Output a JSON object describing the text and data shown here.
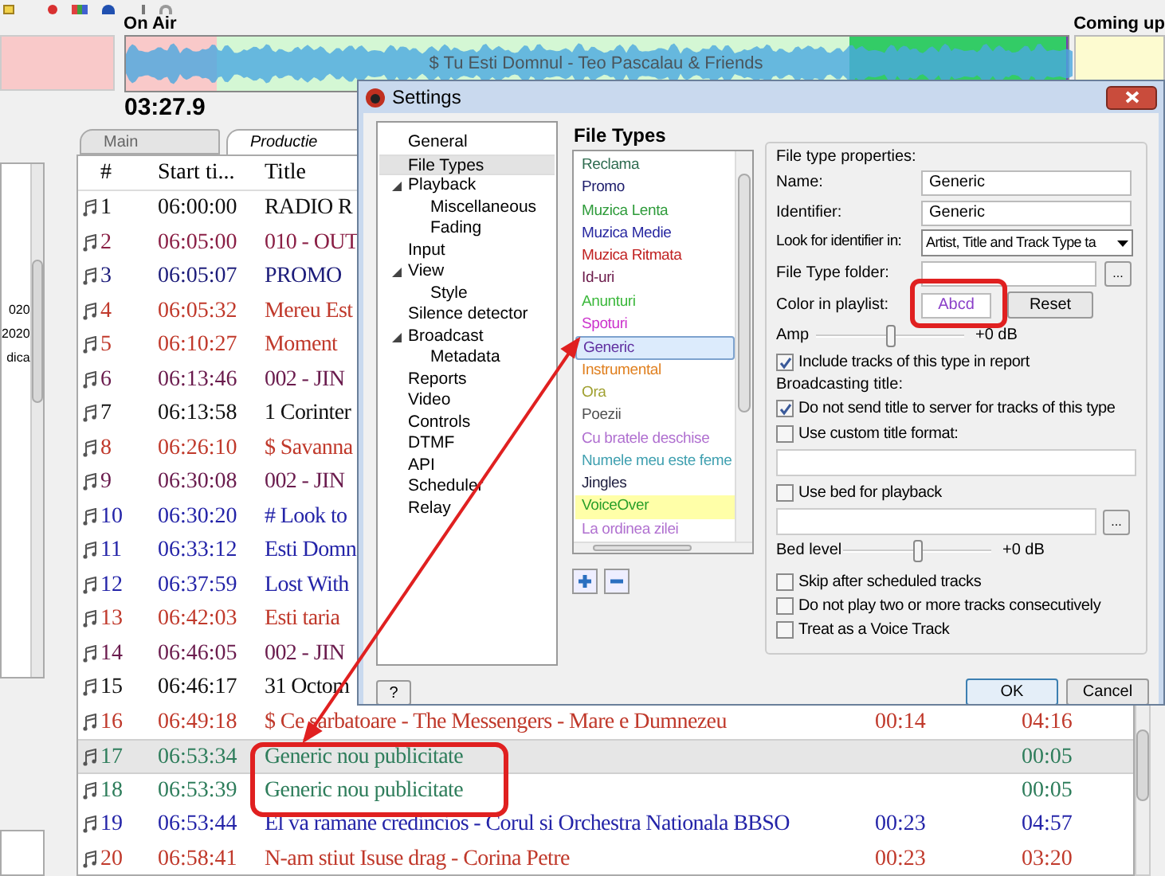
{
  "on_air": {
    "label": "On Air",
    "track": "$ Tu Esti Domnul - Teo Pascalau & Friends",
    "time": "03:27.9"
  },
  "coming_up": {
    "label": "Coming up"
  },
  "left_panel": {
    "lines": [
      "020",
      "2020",
      "dica"
    ]
  },
  "playlist": {
    "tabs": [
      {
        "label": "Main",
        "selected": false
      },
      {
        "label": "Productie",
        "selected": true
      }
    ],
    "columns": [
      "#",
      "Start ti...",
      "Title"
    ],
    "rows": [
      {
        "number": "1",
        "start": "06:00:00",
        "title": "RADIO R",
        "color": "#111111",
        "selected": false
      },
      {
        "number": "2",
        "start": "06:05:00",
        "title": "010 - OUT",
        "color": "#8a1f45",
        "selected": false
      },
      {
        "number": "3",
        "start": "06:05:07",
        "title": "PROMO",
        "color": "#1c1c7a",
        "selected": false
      },
      {
        "number": "4",
        "start": "06:05:32",
        "title": "Mereu Est",
        "color": "#c0392b",
        "selected": false
      },
      {
        "number": "5",
        "start": "06:10:27",
        "title": "Moment",
        "color": "#c0392b",
        "selected": false
      },
      {
        "number": "6",
        "start": "06:13:46",
        "title": "002 - JIN",
        "color": "#6a1b4d",
        "selected": false
      },
      {
        "number": "7",
        "start": "06:13:58",
        "title": "1 Corinter",
        "color": "#111111",
        "selected": false
      },
      {
        "number": "8",
        "start": "06:26:10",
        "title": "$ Savanna",
        "color": "#c0392b",
        "selected": false
      },
      {
        "number": "9",
        "start": "06:30:08",
        "title": "002 - JIN",
        "color": "#6a1b4d",
        "selected": false
      },
      {
        "number": "10",
        "start": "06:30:20",
        "title": "#  Look to",
        "color": "#2424a8",
        "selected": false
      },
      {
        "number": "11",
        "start": "06:33:12",
        "title": "Esti Domn",
        "color": "#2424a8",
        "selected": false
      },
      {
        "number": "12",
        "start": "06:37:59",
        "title": "Lost With",
        "color": "#2424a8",
        "selected": false
      },
      {
        "number": "13",
        "start": "06:42:03",
        "title": "Esti taria",
        "color": "#c0392b",
        "selected": false
      },
      {
        "number": "14",
        "start": "06:46:05",
        "title": "002 - JIN",
        "color": "#6a1b4d",
        "selected": false
      },
      {
        "number": "15",
        "start": "06:46:17",
        "title": "31 Octom",
        "color": "#111111",
        "selected": false
      },
      {
        "number": "16",
        "start": "06:49:18",
        "title": "$ Ce sarbatoare - The Messengers - Mare e Dumnezeu",
        "column_4": "00:14",
        "column_5": "04:16",
        "color": "#c0392b",
        "selected": false
      },
      {
        "number": "17",
        "start": "06:53:34",
        "title": "Generic nou publicitate",
        "column_5": "00:05",
        "color": "#2e7d5b",
        "selected": true
      },
      {
        "number": "18",
        "start": "06:53:39",
        "title": "Generic nou publicitate",
        "column_5": "00:05",
        "color": "#2e7d5b",
        "selected": false
      },
      {
        "number": "19",
        "start": "06:53:44",
        "title": "El va ramane credincios - Corul si Orchestra Nationala BBSO",
        "column_4": "00:23",
        "column_5": "04:57",
        "color": "#2424a8",
        "selected": false
      },
      {
        "number": "20",
        "start": "06:58:41",
        "title": "N-am stiut Isuse drag - Corina Petre",
        "column_4": "00:23",
        "column_5": "03:20",
        "color": "#c0392b",
        "selected": false
      }
    ]
  },
  "dialog": {
    "title": "Settings",
    "tree": [
      {
        "label": "General",
        "selected": false
      },
      {
        "label": "File Types",
        "selected": true
      },
      {
        "label": "Playback",
        "selected": false,
        "expanded": true,
        "children": [
          {
            "label": "Miscellaneous",
            "selected": false
          },
          {
            "label": "Fading",
            "selected": false
          }
        ]
      },
      {
        "label": "Input",
        "selected": false
      },
      {
        "label": "View",
        "selected": false,
        "expanded": true,
        "children": [
          {
            "label": "Style",
            "selected": false
          }
        ]
      },
      {
        "label": "Silence detector",
        "selected": false
      },
      {
        "label": "Broadcast",
        "selected": false,
        "expanded": true,
        "children": [
          {
            "label": "Metadata",
            "selected": false
          }
        ]
      },
      {
        "label": "Reports",
        "selected": false
      },
      {
        "label": "Video",
        "selected": false
      },
      {
        "label": "Controls",
        "selected": false
      },
      {
        "label": "DTMF",
        "selected": false
      },
      {
        "label": "API",
        "selected": false
      },
      {
        "label": "Scheduler",
        "selected": false
      },
      {
        "label": "Relay",
        "selected": false
      }
    ],
    "file_types": {
      "heading": "File Types",
      "items": [
        {
          "label": "Reclama",
          "color": "#2e6b4f",
          "selected": false
        },
        {
          "label": "Promo",
          "color": "#1c1c6b",
          "selected": false
        },
        {
          "label": "Muzica Lenta",
          "color": "#2e9b3a",
          "selected": false
        },
        {
          "label": "Muzica Medie",
          "color": "#2626a0",
          "selected": false
        },
        {
          "label": "Muzica Ritmata",
          "color": "#c02020",
          "selected": false
        },
        {
          "label": "Id-uri",
          "color": "#6b1a4a",
          "selected": false
        },
        {
          "label": "Anunturi",
          "color": "#3cb83c",
          "selected": false
        },
        {
          "label": "Spoturi",
          "color": "#cc33cc",
          "selected": false
        },
        {
          "label": "Generic",
          "color": "#6030a0",
          "selected": true
        },
        {
          "label": "Instrumental",
          "color": "#e08020",
          "selected": false
        },
        {
          "label": "Ora",
          "color": "#a0a030",
          "selected": false
        },
        {
          "label": "Poezii",
          "color": "#505050",
          "selected": false
        },
        {
          "label": "Cu bratele deschise",
          "color": "#b070d0",
          "selected": false
        },
        {
          "label": "Numele meu este feme",
          "color": "#40a0b0",
          "selected": false
        },
        {
          "label": "Jingles",
          "color": "#202040",
          "selected": false
        },
        {
          "label": "VoiceOver",
          "color": "#2aa02a",
          "selected": false,
          "highlighted": true
        },
        {
          "label": "La ordinea zilei",
          "color": "#b070d0",
          "selected": false
        }
      ]
    },
    "properties": {
      "group_title": "File type properties:",
      "name": {
        "label": "Name:",
        "value": "Generic"
      },
      "identifier": {
        "label": "Identifier:",
        "value": "Generic"
      },
      "look_for": {
        "label": "Look for identifier in:",
        "value": "Artist, Title and Track Type ta"
      },
      "folder": {
        "label": "File Type folder:",
        "browse": "..."
      },
      "color": {
        "label": "Color in playlist:",
        "sample": "Abcd",
        "color": "#8a3fc8",
        "reset": "Reset"
      },
      "amp": {
        "label": "Amp",
        "level": 0.5,
        "reading": "+0 dB"
      },
      "include_in_report": {
        "label": "Include tracks of this type in report",
        "checked": true
      },
      "broadcasting_title": "Broadcasting title:",
      "do_not_send": {
        "label": "Do not send title to server for tracks of this type",
        "checked": true
      },
      "custom_title": {
        "label": "Use custom title format:",
        "checked": false
      },
      "use_bed": {
        "label": "Use bed for playback",
        "checked": false,
        "browse": "..."
      },
      "bed_level": {
        "label": "Bed level",
        "level": 0.5,
        "reading": "+0 dB"
      },
      "options": [
        {
          "label": "Skip after scheduled tracks",
          "checked": false
        },
        {
          "label": "Do not play two or more tracks consecutively",
          "checked": false
        },
        {
          "label": "Treat as a Voice Track",
          "checked": false
        }
      ]
    },
    "buttons": {
      "help": "?",
      "ok": "OK",
      "cancel": "Cancel"
    }
  }
}
